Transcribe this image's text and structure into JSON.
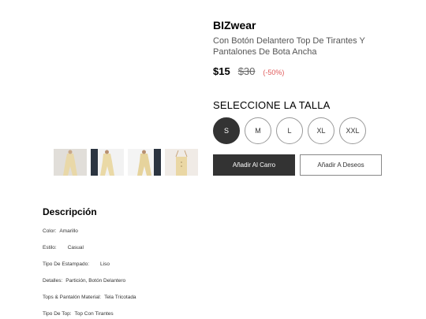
{
  "product": {
    "brand": "BIZwear",
    "title": "Con Botón Delantero Top De Tirantes Y Pantalones De Bota Ancha",
    "price": "$15",
    "old_price": "$30",
    "discount": "(-50%)"
  },
  "sizes": {
    "heading": "SELECCIONE LA TALLA",
    "options": [
      "S",
      "M",
      "L",
      "XL",
      "XXL"
    ],
    "selected": "S"
  },
  "actions": {
    "add_to_cart": "Añadir Al Carro",
    "add_to_wishlist": "Añadir A Deseos"
  },
  "description": {
    "heading": "Descripción",
    "rows": [
      {
        "key": "Color:",
        "value": "Amarillo"
      },
      {
        "key": "Estilo:",
        "value": "Casual"
      },
      {
        "key": "Tipo De Estampado:",
        "value": "Liso"
      },
      {
        "key": "Detalles:",
        "value": "Partición, Botón Delantero"
      },
      {
        "key": "Tops & Pantalón Material:",
        "value": "Tela Tricotada"
      },
      {
        "key": "Tipo De Top:",
        "value": "Top Con Tirantes"
      }
    ]
  },
  "colors": {
    "dark": "#333333",
    "discount": "#e05a5a",
    "garment": "#e9d8a8"
  }
}
